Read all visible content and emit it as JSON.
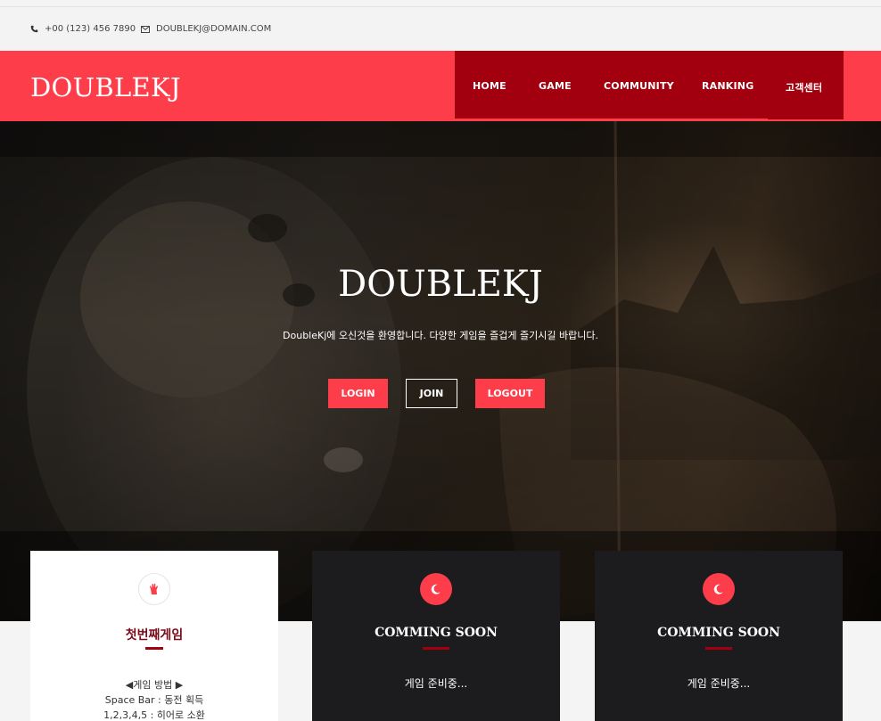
{
  "topbar": {
    "phone": "+00 (123) 456 7890",
    "email": "DOUBLEKJ@DOMAIN.COM"
  },
  "header": {
    "logo": "DOUBLEKJ",
    "nav": [
      "HOME",
      "GAME",
      "COMMUNITY",
      "RANKING",
      "고객센터"
    ]
  },
  "hero": {
    "title": "DOUBLEKJ",
    "subtitle": "DoubleKj에 오신것을 환영합니다. 다양한 게임을 즐겁게 즐기시길 바랍니다.",
    "buttons": {
      "login": "LOGIN",
      "join": "JOIN",
      "logout": "LOGOUT"
    }
  },
  "cards": [
    {
      "title": "첫번째게임",
      "icon": "hand-icon",
      "lines": [
        "◀게임 방법 ▶",
        "Space Bar : 동전 획득",
        "1,2,3,4,5 : 히어로 소환"
      ]
    },
    {
      "title": "COMMING SOON",
      "icon": "moon-icon",
      "text": "게임 준비중..."
    },
    {
      "title": "COMMING SOON",
      "icon": "moon-icon",
      "text": "게임 준비중..."
    }
  ],
  "colors": {
    "accent": "#fd3e4a",
    "dark_red": "#a3000f",
    "card_dark": "#1c1c1f"
  }
}
